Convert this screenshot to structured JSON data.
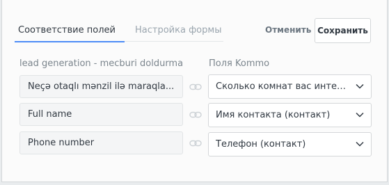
{
  "tabs": {
    "active_label": "Соответствие полей",
    "inactive_label": "Настройка формы"
  },
  "actions": {
    "cancel_label": "Отменить",
    "save_label": "Сохранить"
  },
  "columns": {
    "left_header": "lead generation - mecburi doldurma",
    "right_header": "Поля Kommo"
  },
  "mappings": [
    {
      "source": "Neçə otaqlı mənzil ilə maraqla...",
      "target": "Сколько комнат вас интерес..."
    },
    {
      "source": "Full name",
      "target": "Имя контакта (контакт)"
    },
    {
      "source": "Phone number",
      "target": "Телефон (контакт)"
    }
  ],
  "colors": {
    "accent": "#4c8bf7",
    "panel_bg": "#fbfbfb",
    "text": "#313942",
    "muted": "#9aa5ae"
  },
  "icons": {
    "link": "link-icon",
    "chevron": "chevron-down-icon"
  }
}
